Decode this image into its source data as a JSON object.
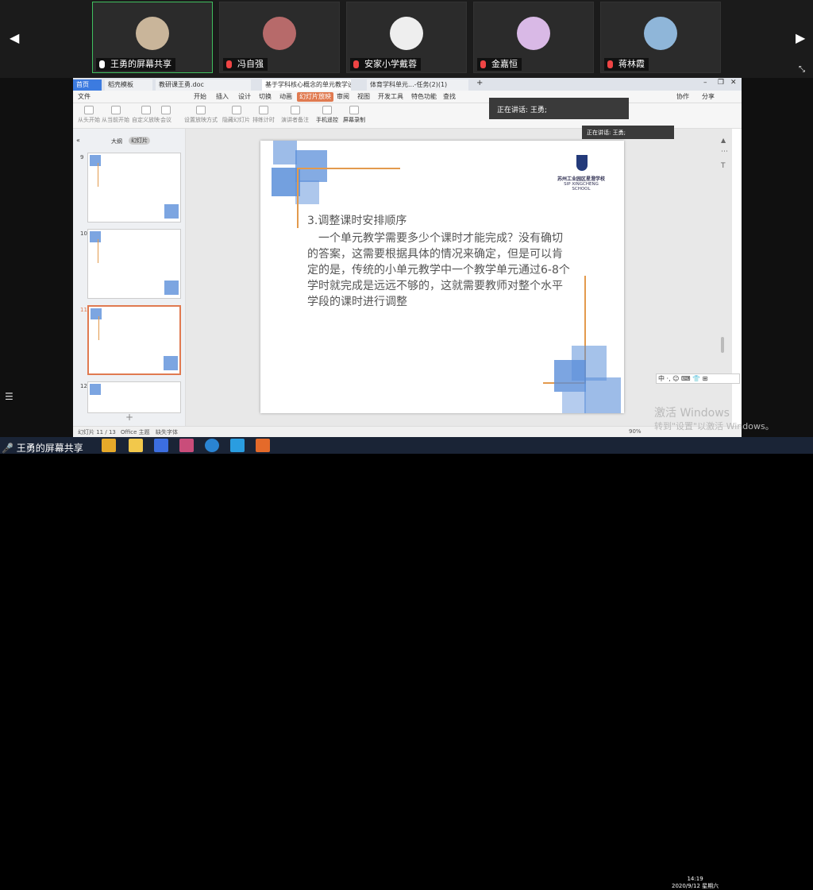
{
  "meeting": {
    "participants": [
      {
        "name": "王勇的屏幕共享",
        "muted": false,
        "active": true
      },
      {
        "name": "冯自强",
        "muted": true,
        "active": false
      },
      {
        "name": "安家小学戴蓉",
        "muted": true,
        "active": false
      },
      {
        "name": "金嘉恒",
        "muted": true,
        "active": false
      },
      {
        "name": "蒋林霞",
        "muted": true,
        "active": false
      }
    ],
    "speaking_main": "正在讲话: 王勇;",
    "speaking_small": "正在讲话: 王勇;",
    "share_label": "王勇的屏幕共享"
  },
  "wps": {
    "tabs": [
      "首页",
      "稻壳模板",
      "教研课王勇.doc",
      "基于学科核心概念的单元教学设计",
      "体育学科单元...-任务(2)(1)"
    ],
    "ribbon_tabs": [
      "文件",
      "开始",
      "插入",
      "设计",
      "切换",
      "动画",
      "幻灯片放映",
      "审阅",
      "视图",
      "开发工具",
      "特色功能",
      "查找",
      "协作",
      "分享"
    ],
    "tools": [
      "从头开始",
      "从当前开始",
      "自定义放映",
      "会议",
      "设置放映方式",
      "隐藏幻灯片",
      "排练计时",
      "演讲者备注",
      "手机遥控",
      "屏幕录制"
    ],
    "panel_tabs": [
      "大纲",
      "幻灯片"
    ],
    "thumbs": [
      {
        "num": "9",
        "selected": false
      },
      {
        "num": "10",
        "selected": false
      },
      {
        "num": "11",
        "selected": true
      },
      {
        "num": "12",
        "selected": false
      }
    ],
    "slide": {
      "title": "3.调整课时安排顺序",
      "body": "　一个单元教学需要多少个课时才能完成？没有确切的答案，这需要根据具体的情况来确定，但是可以肯定的是，传统的小单元教学中一个教学单元通过6-8个学时就完成是远远不够的，这就需要教师对整个水平学段的课时进行调整",
      "logo_cn": "苏州工业园区星澄学校",
      "logo_en": "SIP XINGCHENG SCHOOL"
    },
    "status": {
      "slide": "幻灯片 11 / 13",
      "theme": "Office 主题",
      "font": "缺失字体",
      "zoom": "90%"
    }
  },
  "os": {
    "activate_1": "激活 Windows",
    "activate_2": "转到\"设置\"以激活 Windows。",
    "time": "14:19",
    "date": "2020/9/12 星期六",
    "ime": "中 ·, ☺ ⌨ 👕 ⊞"
  },
  "colors": {
    "accent_blue": "#5b8fd9",
    "accent_orange": "#e39a4d",
    "ribbon_active": "#e07a50"
  }
}
